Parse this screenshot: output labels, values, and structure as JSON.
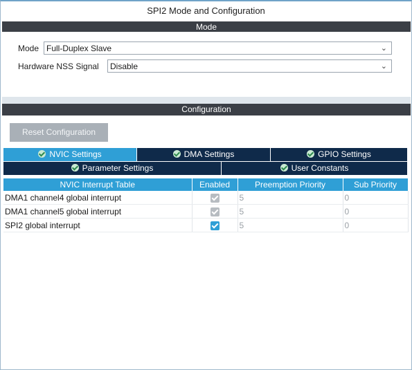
{
  "window": {
    "title": "SPI2 Mode and Configuration"
  },
  "mode_section": {
    "header": "Mode",
    "mode_label": "Mode",
    "mode_value": "Full-Duplex Slave",
    "nss_label": "Hardware NSS Signal",
    "nss_value": "Disable"
  },
  "config_section": {
    "header": "Configuration",
    "reset_button": "Reset Configuration",
    "tabs_row1": [
      "NVIC Settings",
      "DMA Settings",
      "GPIO Settings"
    ],
    "tabs_row2": [
      "Parameter Settings",
      "User Constants"
    ],
    "active_tab": "NVIC Settings"
  },
  "nvic_table": {
    "headers": [
      "NVIC Interrupt Table",
      "Enabled",
      "Preemption Priority",
      "Sub Priority"
    ],
    "rows": [
      {
        "name": "DMA1 channel4 global interrupt",
        "enabled": true,
        "editable": false,
        "preemption": "5",
        "sub": "0"
      },
      {
        "name": "DMA1 channel5 global interrupt",
        "enabled": true,
        "editable": false,
        "preemption": "5",
        "sub": "0"
      },
      {
        "name": "SPI2 global interrupt",
        "enabled": true,
        "editable": true,
        "preemption": "5",
        "sub": "0"
      }
    ]
  },
  "colors": {
    "section_header": "#3b3f46",
    "tab_active": "#2f9fd6",
    "tab_inactive": "#0f2a4a",
    "table_header": "#2f9fd6",
    "reset_button": "#a9b0b7"
  }
}
